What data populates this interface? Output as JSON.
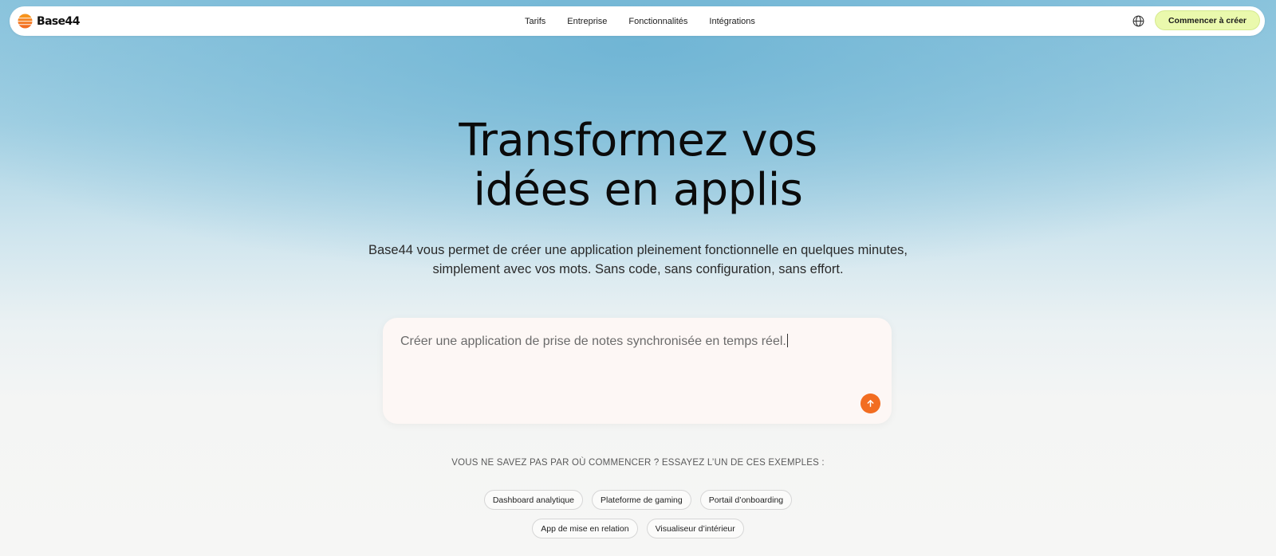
{
  "brand": {
    "name": "Base44",
    "logo_colors": [
      "#f7941d",
      "#f26d21"
    ]
  },
  "nav": {
    "links": [
      "Tarifs",
      "Entreprise",
      "Fonctionnalités",
      "Intégrations"
    ],
    "language_icon": "globe-icon",
    "cta_label": "Commencer à créer",
    "cta_color": "#eaf9ad"
  },
  "hero": {
    "title_line1": "Transformez vos",
    "title_line2": "idées en applis",
    "subtitle_line1": "Base44 vous permet de créer une application pleinement fonctionnelle en quelques minutes,",
    "subtitle_line2": "simplement avec vos mots. Sans code, sans configuration, sans effort."
  },
  "prompt": {
    "value": "Créer une application de prise de notes synchronisée en temps réel.",
    "send_icon": "arrow-up-icon",
    "send_color": "#f26d21"
  },
  "examples": {
    "label": "VOUS NE SAVEZ PAS PAR OÙ COMMENCER ? ESSAYEZ L’UN DE CES EXEMPLES :",
    "row1": [
      "Dashboard analytique",
      "Plateforme de gaming",
      "Portail d’onboarding"
    ],
    "row2": [
      "App de mise en relation",
      "Visualiseur d’intérieur"
    ]
  }
}
